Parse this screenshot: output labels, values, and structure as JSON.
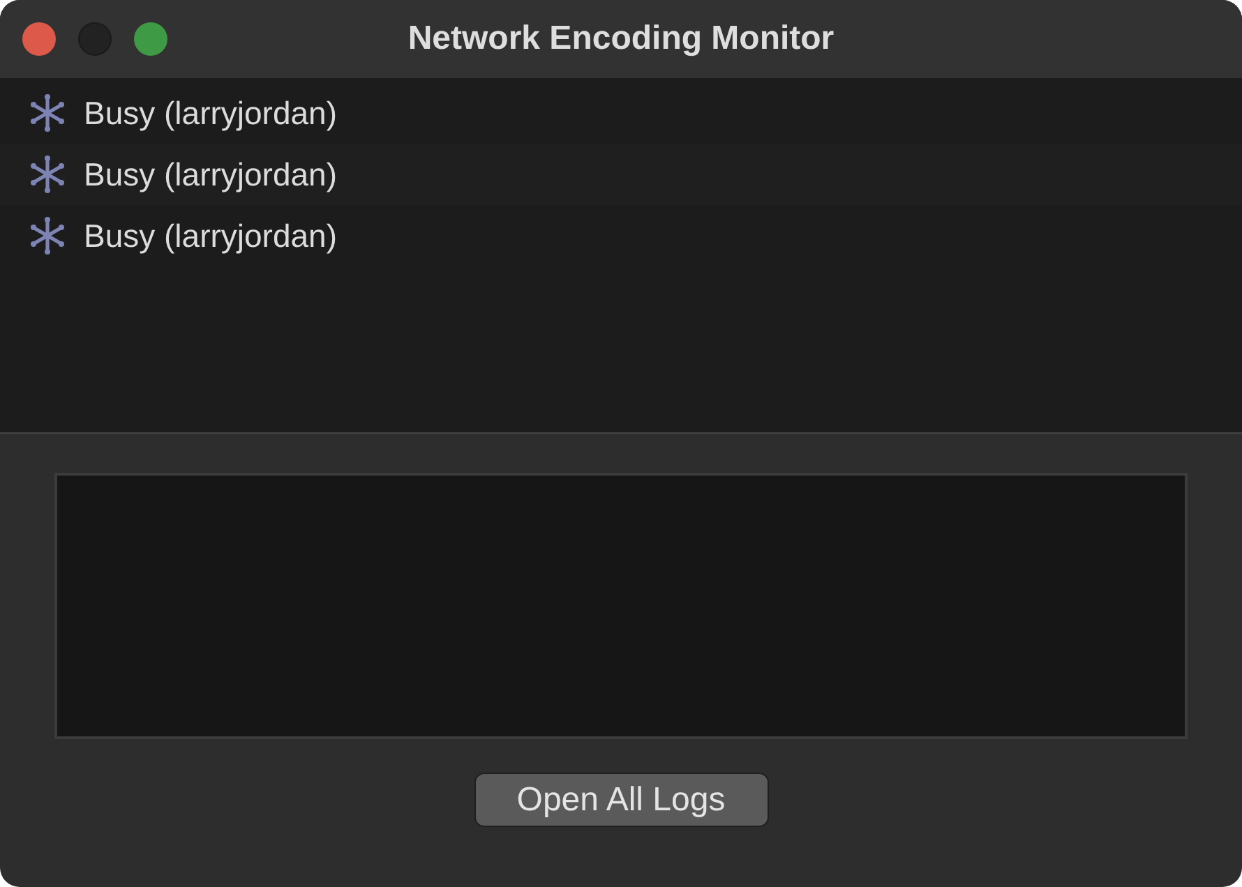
{
  "window": {
    "title": "Network Encoding Monitor",
    "controls": [
      {
        "kind": "close",
        "disabled": false
      },
      {
        "kind": "minimize",
        "disabled": true
      },
      {
        "kind": "zoom",
        "disabled": false
      }
    ]
  },
  "jobs": [
    {
      "label": "Busy (larryjordan)"
    },
    {
      "label": "Busy (larryjordan)"
    },
    {
      "label": "Busy (larryjordan)"
    }
  ],
  "buttons": [
    {
      "label": "Open All Logs"
    }
  ]
}
